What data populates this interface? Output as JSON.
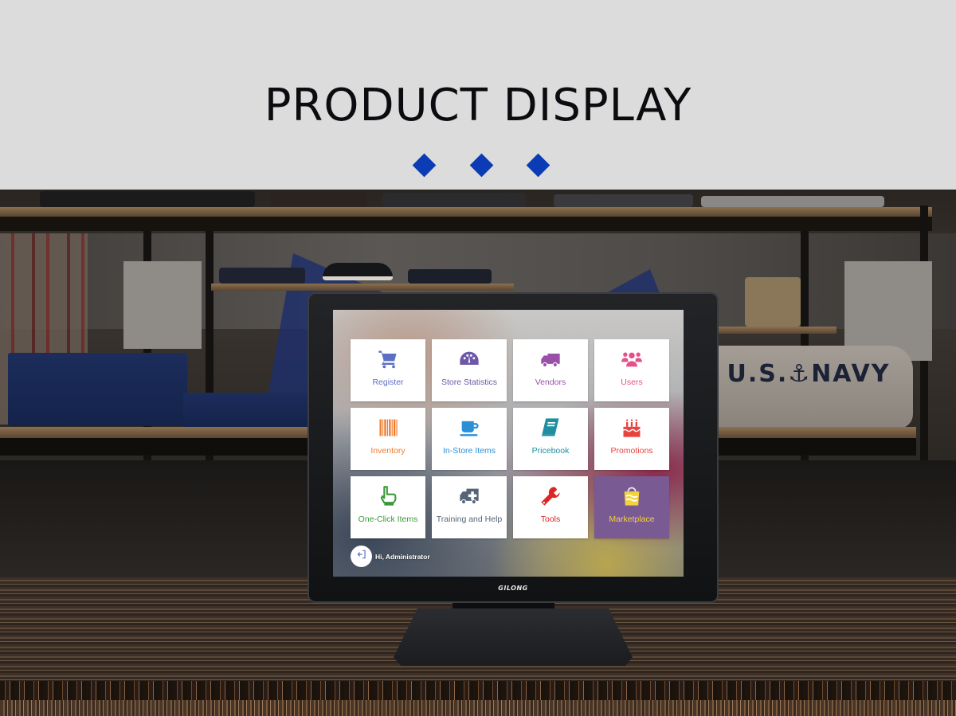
{
  "header": {
    "title": "PRODUCT DISPLAY",
    "accent_color": "#0b3cb5",
    "decor": [
      "diamond-icon",
      "diamond-icon",
      "diamond-icon"
    ]
  },
  "scene": {
    "blanket_text": "U.S.⚓NAVY"
  },
  "monitor": {
    "brand": "GILONG"
  },
  "pos_app": {
    "tiles": [
      {
        "label": "Register",
        "icon": "shopping-cart-icon",
        "color": "#5b6fc4"
      },
      {
        "label": "Store Statistics",
        "icon": "dashboard-gauge-icon",
        "color": "#6e57a8"
      },
      {
        "label": "Vendors",
        "icon": "truck-icon",
        "color": "#9a4fa8"
      },
      {
        "label": "Users",
        "icon": "users-group-icon",
        "color": "#e6508a"
      },
      {
        "label": "Inventory",
        "icon": "barcode-icon",
        "color": "#ef7b2e"
      },
      {
        "label": "In-Store Items",
        "icon": "coffee-cup-icon",
        "color": "#2b8fd6"
      },
      {
        "label": "Pricebook",
        "icon": "book-icon",
        "color": "#1f8fa0"
      },
      {
        "label": "Promotions",
        "icon": "birthday-cake-icon",
        "color": "#e8433f"
      },
      {
        "label": "One-Click Items",
        "icon": "pointing-hand-icon",
        "color": "#3a9a3a"
      },
      {
        "label": "Training and Help",
        "icon": "ambulance-icon",
        "color": "#556577"
      },
      {
        "label": "Tools",
        "icon": "wrench-icon",
        "color": "#e02424"
      },
      {
        "label": "Marketplace",
        "icon": "shopping-bag-icon",
        "color": "#f2d33a",
        "background": "#7a5a93"
      }
    ],
    "greeting": "Hi, Administrator",
    "logout_icon": "sign-out-icon"
  }
}
